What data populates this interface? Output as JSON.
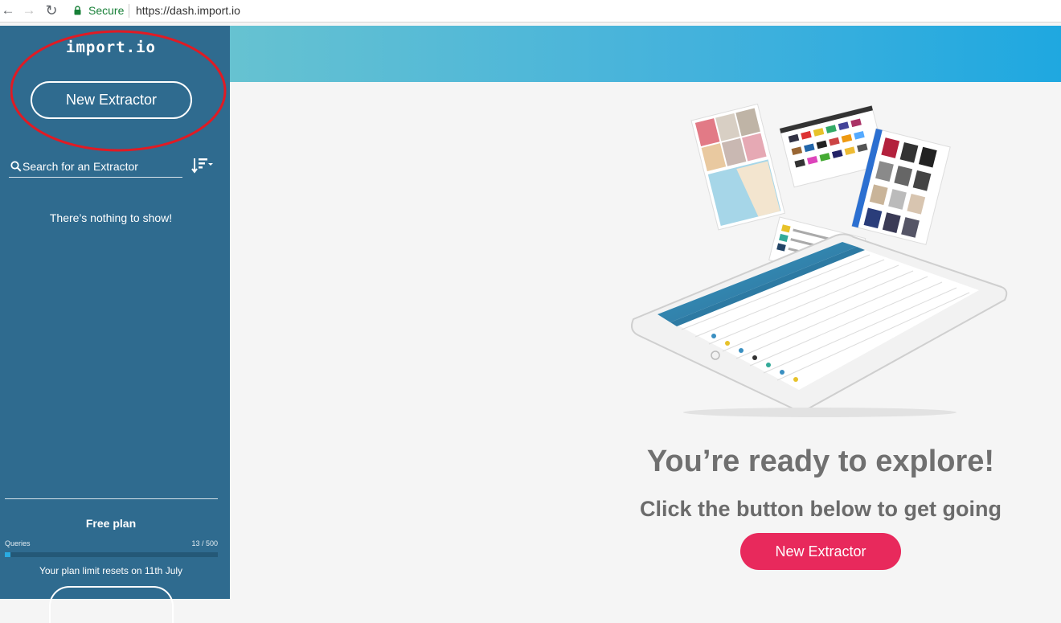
{
  "browser": {
    "secure_label": "Secure",
    "url": "https://dash.import.io"
  },
  "sidebar": {
    "logo": "import.io",
    "new_extractor_label": "New Extractor",
    "search": {
      "placeholder": "Search for an Extractor",
      "value": ""
    },
    "empty_message": "There’s nothing to show!",
    "plan": {
      "title": "Free plan",
      "queries_label": "Queries",
      "queries_count": "13 / 500",
      "queries_used": 13,
      "queries_limit": 500,
      "reset_message": "Your plan limit resets on 11th July"
    }
  },
  "main": {
    "headline": "You’re ready to explore!",
    "subhead": "Click the button below to get going",
    "cta_label": "New Extractor"
  },
  "colors": {
    "sidebar": "#2f6b8f",
    "cta": "#e8295c",
    "annotation": "#e01b24",
    "header_gradient_start": "#66c2d1",
    "header_gradient_end": "#1fa8e0"
  },
  "icons": [
    "back-icon",
    "forward-icon",
    "reload-icon",
    "lock-icon",
    "search-icon",
    "sort-icon"
  ]
}
